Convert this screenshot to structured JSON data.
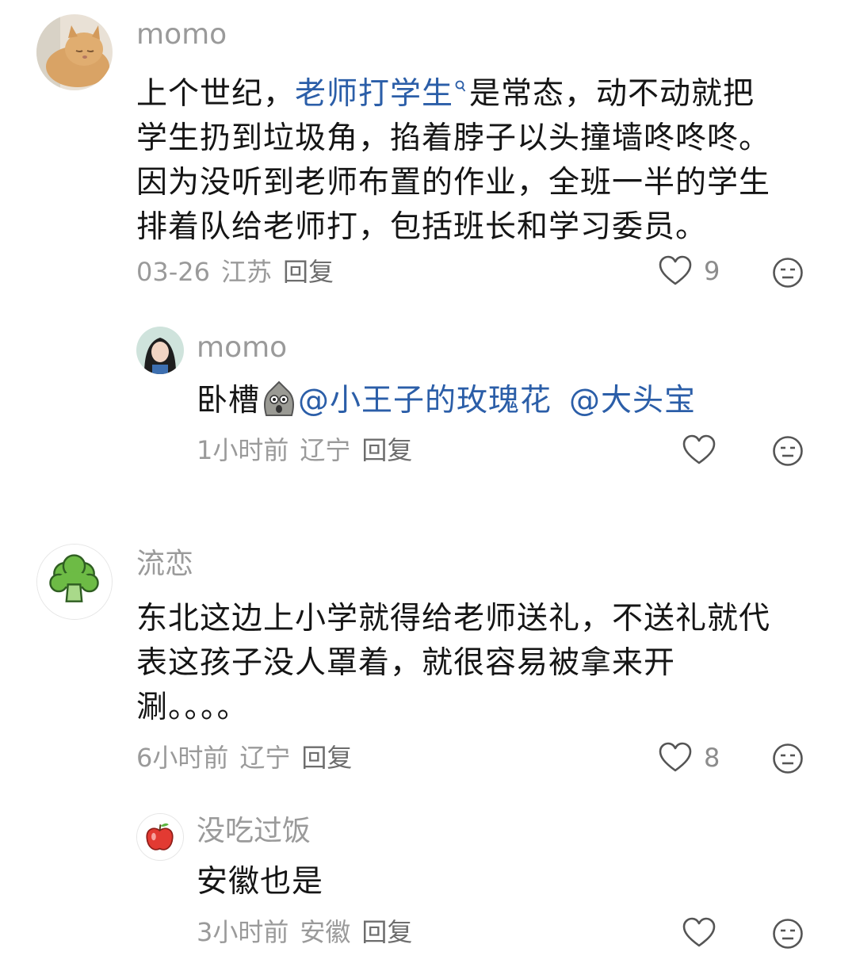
{
  "comments": [
    {
      "username": "momo",
      "avatar_icon": "cat-avatar-icon",
      "text": {
        "line1_a": "上个世纪，",
        "line1_link": "老师打学生",
        "line1_b": "是常态，动不动就把",
        "line2": "学生扔到垃圾角，掐着脖子以头撞墙咚咚咚。",
        "line3": "因为没听到老师布置的作业，全班一半的学生",
        "line4": "排着队给老师打，包括班长和学习委员。"
      },
      "date": "03-26",
      "location": "江苏",
      "reply_label": "回复",
      "like_count": "9",
      "replies": [
        {
          "username": "momo",
          "avatar_icon": "girl-avatar-icon",
          "text_a": "卧槽",
          "emoji_icon": "shocked-emoji-icon",
          "mention1": "@小王子的玫瑰花",
          "mention2": "@大头宝",
          "date": "1小时前",
          "location": "辽宁",
          "reply_label": "回复"
        }
      ]
    },
    {
      "username": "流恋",
      "avatar_icon": "broccoli-avatar-icon",
      "text": {
        "line1": "东北这边上小学就得给老师送礼，不送礼就代",
        "line2": "表这孩子没人罩着，就很容易被拿来开",
        "line3": "涮。。。。"
      },
      "date": "6小时前",
      "location": "辽宁",
      "reply_label": "回复",
      "like_count": "8",
      "replies": [
        {
          "username": "没吃过饭",
          "avatar_icon": "apple-avatar-icon",
          "text": "安徽也是",
          "date": "3小时前",
          "location": "安徽",
          "reply_label": "回复"
        }
      ]
    }
  ],
  "colors": {
    "link": "#2b5ea8",
    "meta": "#9a9a9a",
    "text": "#151515"
  }
}
